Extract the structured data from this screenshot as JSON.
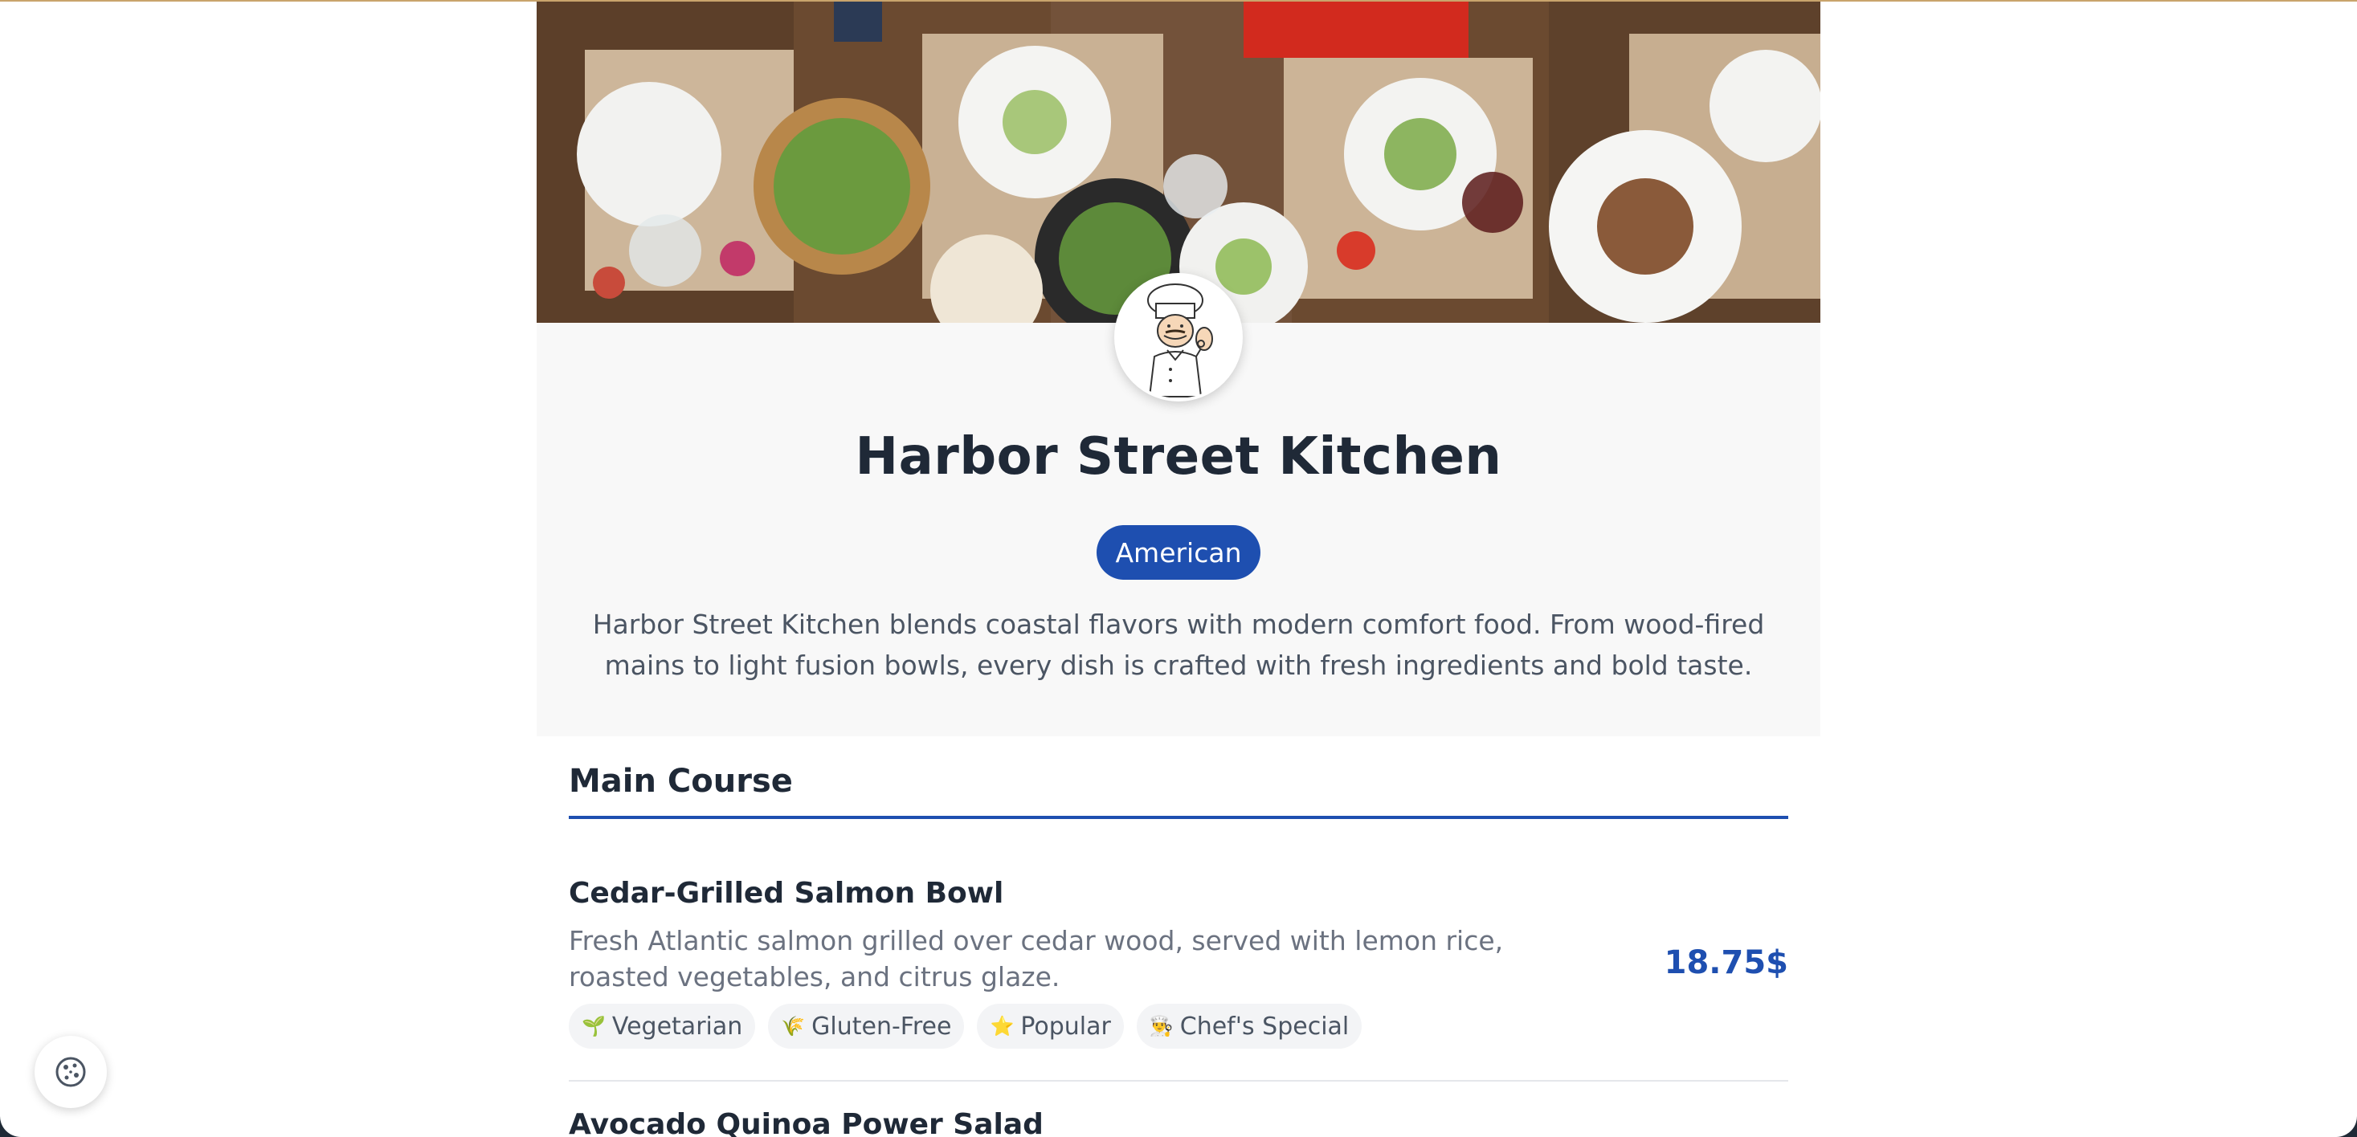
{
  "restaurant": {
    "name": "Harbor Street Kitchen",
    "cuisine": "American",
    "description": "Harbor Street Kitchen blends coastal flavors with modern comfort food. From wood-fired mains to light fusion bowls, every dish is crafted with fresh ingredients and bold taste."
  },
  "images": {
    "hero": "overhead-dining-table-photo",
    "avatar": "chef-mascot-illustration"
  },
  "menu": {
    "section_title": "Main Course",
    "items": [
      {
        "name": "Cedar-Grilled Salmon Bowl",
        "description": "Fresh Atlantic salmon grilled over cedar wood, served with lemon rice, roasted vegetables, and citrus glaze.",
        "price": "18.75$",
        "tags": [
          {
            "icon": "seedling-icon",
            "glyph": "🌱",
            "label": "Vegetarian"
          },
          {
            "icon": "wheat-icon",
            "glyph": "🌾",
            "label": "Gluten-Free"
          },
          {
            "icon": "star-icon",
            "glyph": "⭐",
            "label": "Popular"
          },
          {
            "icon": "chef-icon",
            "glyph": "👨‍🍳",
            "label": "Chef's Special"
          }
        ]
      },
      {
        "name": "Avocado Quinoa Power Salad"
      }
    ]
  },
  "cookie_settings": {
    "icon": "cookie-icon"
  },
  "colors": {
    "accent": "#1e4fb0",
    "title": "#1f2937",
    "muted": "#6b7280",
    "tag_bg": "#f3f4f6"
  }
}
